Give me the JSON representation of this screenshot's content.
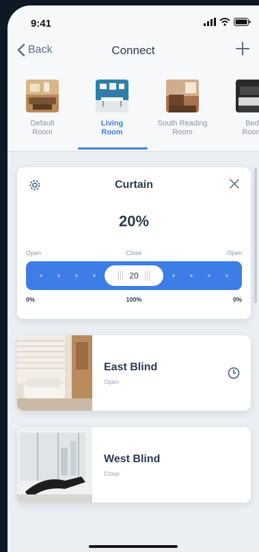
{
  "status": {
    "time": "9:41"
  },
  "nav": {
    "back_label": "Back",
    "title": "Connect"
  },
  "rooms": [
    {
      "label": "Default\nRoom",
      "active": false
    },
    {
      "label": "Living\nRoom",
      "active": true
    },
    {
      "label": "South Reading\nRoom",
      "active": false
    },
    {
      "label": "Bed\nRoom",
      "active": false
    }
  ],
  "curtain": {
    "title": "Curtain",
    "percent_label": "20%",
    "position_percent": 20,
    "label_left": "Open",
    "label_center": "Close",
    "label_right": "Open",
    "slider_value": "20",
    "bottom_left": "0%",
    "bottom_center": "100%",
    "bottom_right": "0%"
  },
  "blinds": [
    {
      "name": "East Blind",
      "status": "Open"
    },
    {
      "name": "West Blind",
      "status": "Close"
    }
  ],
  "colors": {
    "accent": "#3d7de6",
    "text": "#2b3a4f",
    "background": "#ebeef2"
  },
  "icons": [
    "signal-icon",
    "wifi-icon",
    "battery-icon",
    "chevron-left-icon",
    "plus-icon",
    "gear-icon",
    "close-icon",
    "clock-icon"
  ]
}
